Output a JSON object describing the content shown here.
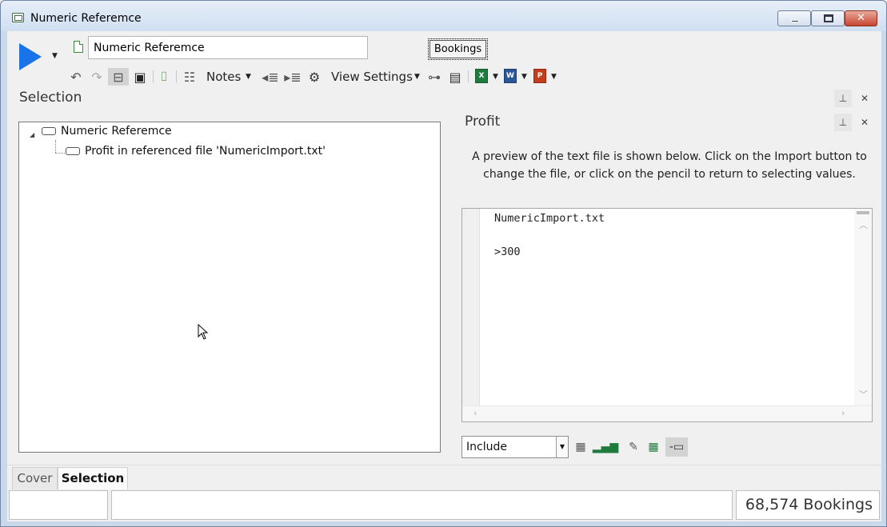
{
  "window": {
    "title": "Numeric Referemce"
  },
  "toolbar": {
    "name_value": "Numeric Referemce",
    "bookings_label": "Bookings",
    "notes_label": "Notes",
    "view_settings_label": "View Settings"
  },
  "selection_pane": {
    "title": "Selection",
    "tree": {
      "root_label": "Numeric Referemce",
      "child_label": "Profit in referenced file 'NumericImport.txt'"
    }
  },
  "profit_pane": {
    "title": "Profit",
    "description": "A preview of the text file is shown below. Click on the Import button to change the file, or click on the pencil to return to selecting values.",
    "preview_lines": [
      "NumericImport.txt",
      ">300"
    ],
    "mode_select": "Include"
  },
  "tabs": [
    {
      "label": "Cover",
      "active": false
    },
    {
      "label": "Selection",
      "active": true
    }
  ],
  "statusbar": {
    "count_text": "68,574 Bookings"
  },
  "colors": {
    "run_blue": "#1a73e8",
    "excel_green": "#1e7b3c",
    "word_blue": "#2b579a",
    "powerpoint_red": "#c43e1c"
  }
}
